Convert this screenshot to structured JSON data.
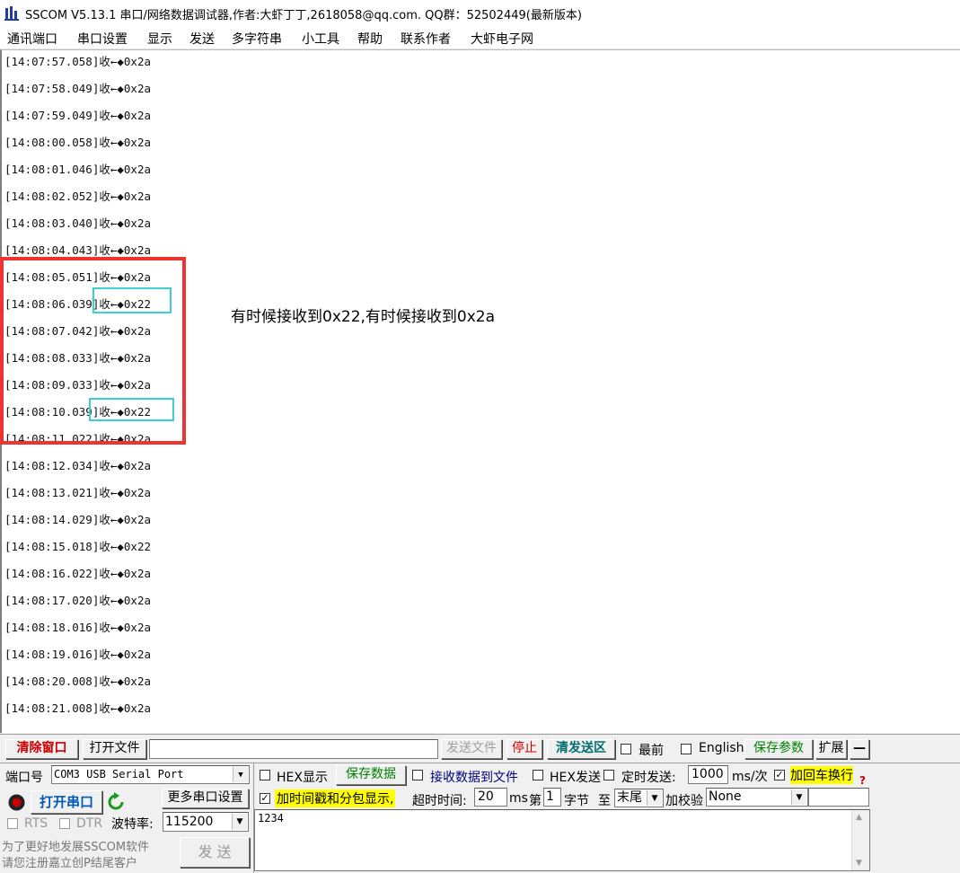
{
  "app": {
    "title": "SSCOM V5.13.1 串口/网络数据调试器,作者:大虾丁丁,2618058@qq.com. QQ群：52502449(最新版本)"
  },
  "menu": [
    "通讯端口",
    "串口设置",
    "显示",
    "发送",
    "多字符串",
    "小工具",
    "帮助",
    "联系作者",
    "大虾电子网"
  ],
  "log": [
    "[14:07:57.058]收←◆0x2a",
    "[14:07:58.049]收←◆0x2a",
    "[14:07:59.049]收←◆0x2a",
    "[14:08:00.058]收←◆0x2a",
    "[14:08:01.046]收←◆0x2a",
    "[14:08:02.052]收←◆0x2a",
    "[14:08:03.040]收←◆0x2a",
    "[14:08:04.043]收←◆0x2a",
    "[14:08:05.051]收←◆0x2a",
    "[14:08:06.039]收←◆0x22",
    "[14:08:07.042]收←◆0x2a",
    "[14:08:08.033]收←◆0x2a",
    "[14:08:09.033]收←◆0x2a",
    "[14:08:10.039]收←◆0x22",
    "[14:08:11.022]收←◆0x2a",
    "[14:08:12.034]收←◆0x2a",
    "[14:08:13.021]收←◆0x2a",
    "[14:08:14.029]收←◆0x2a",
    "[14:08:15.018]收←◆0x22",
    "[14:08:16.022]收←◆0x2a",
    "[14:08:17.020]收←◆0x2a",
    "[14:08:18.016]收←◆0x2a",
    "[14:08:19.016]收←◆0x2a",
    "[14:08:20.008]收←◆0x2a",
    "[14:08:21.008]收←◆0x2a"
  ],
  "annotation": {
    "note": "有时候接收到0x22,有时候接收到0x2a"
  },
  "toolbar": {
    "clear_window": "清除窗口",
    "open_file": "打开文件",
    "send_file": "发送文件",
    "stop": "停止",
    "clear_send": "清发送区",
    "topmost": "最前",
    "english": "English",
    "save_params": "保存参数",
    "expand": "扩展",
    "collapse": "—"
  },
  "port": {
    "port_label": "端口号",
    "port_value": "COM3 USB Serial Port",
    "open_button": "打开串口",
    "more_settings": "更多串口设置",
    "rts": "RTS",
    "dtr": "DTR",
    "baud_label": "波特率:",
    "baud_value": "115200",
    "promo_line1": "为了更好地发展SSCOM软件",
    "promo_line2": "请您注册嘉立创P结尾客户"
  },
  "options": {
    "hex_display": "HEX显示",
    "save_data": "保存数据",
    "recv_to_file": "接收数据到文件",
    "hex_send": "HEX发送",
    "timed_send": "定时发送:",
    "interval": "1000",
    "interval_unit": "ms/次",
    "add_crlf": "加回车换行",
    "timestamp": "加时间戳和分包显示,",
    "timeout_label": "超时时间:",
    "timeout_value": "20",
    "timeout_unit": "ms",
    "byte_label_1": "第",
    "byte_value": "1",
    "byte_label_2": "字节",
    "to_label": "至",
    "end_value": "末尾",
    "checksum_label": "加校验",
    "checksum_value": "None"
  },
  "send": {
    "text": "1234",
    "send_button": "发 送"
  }
}
